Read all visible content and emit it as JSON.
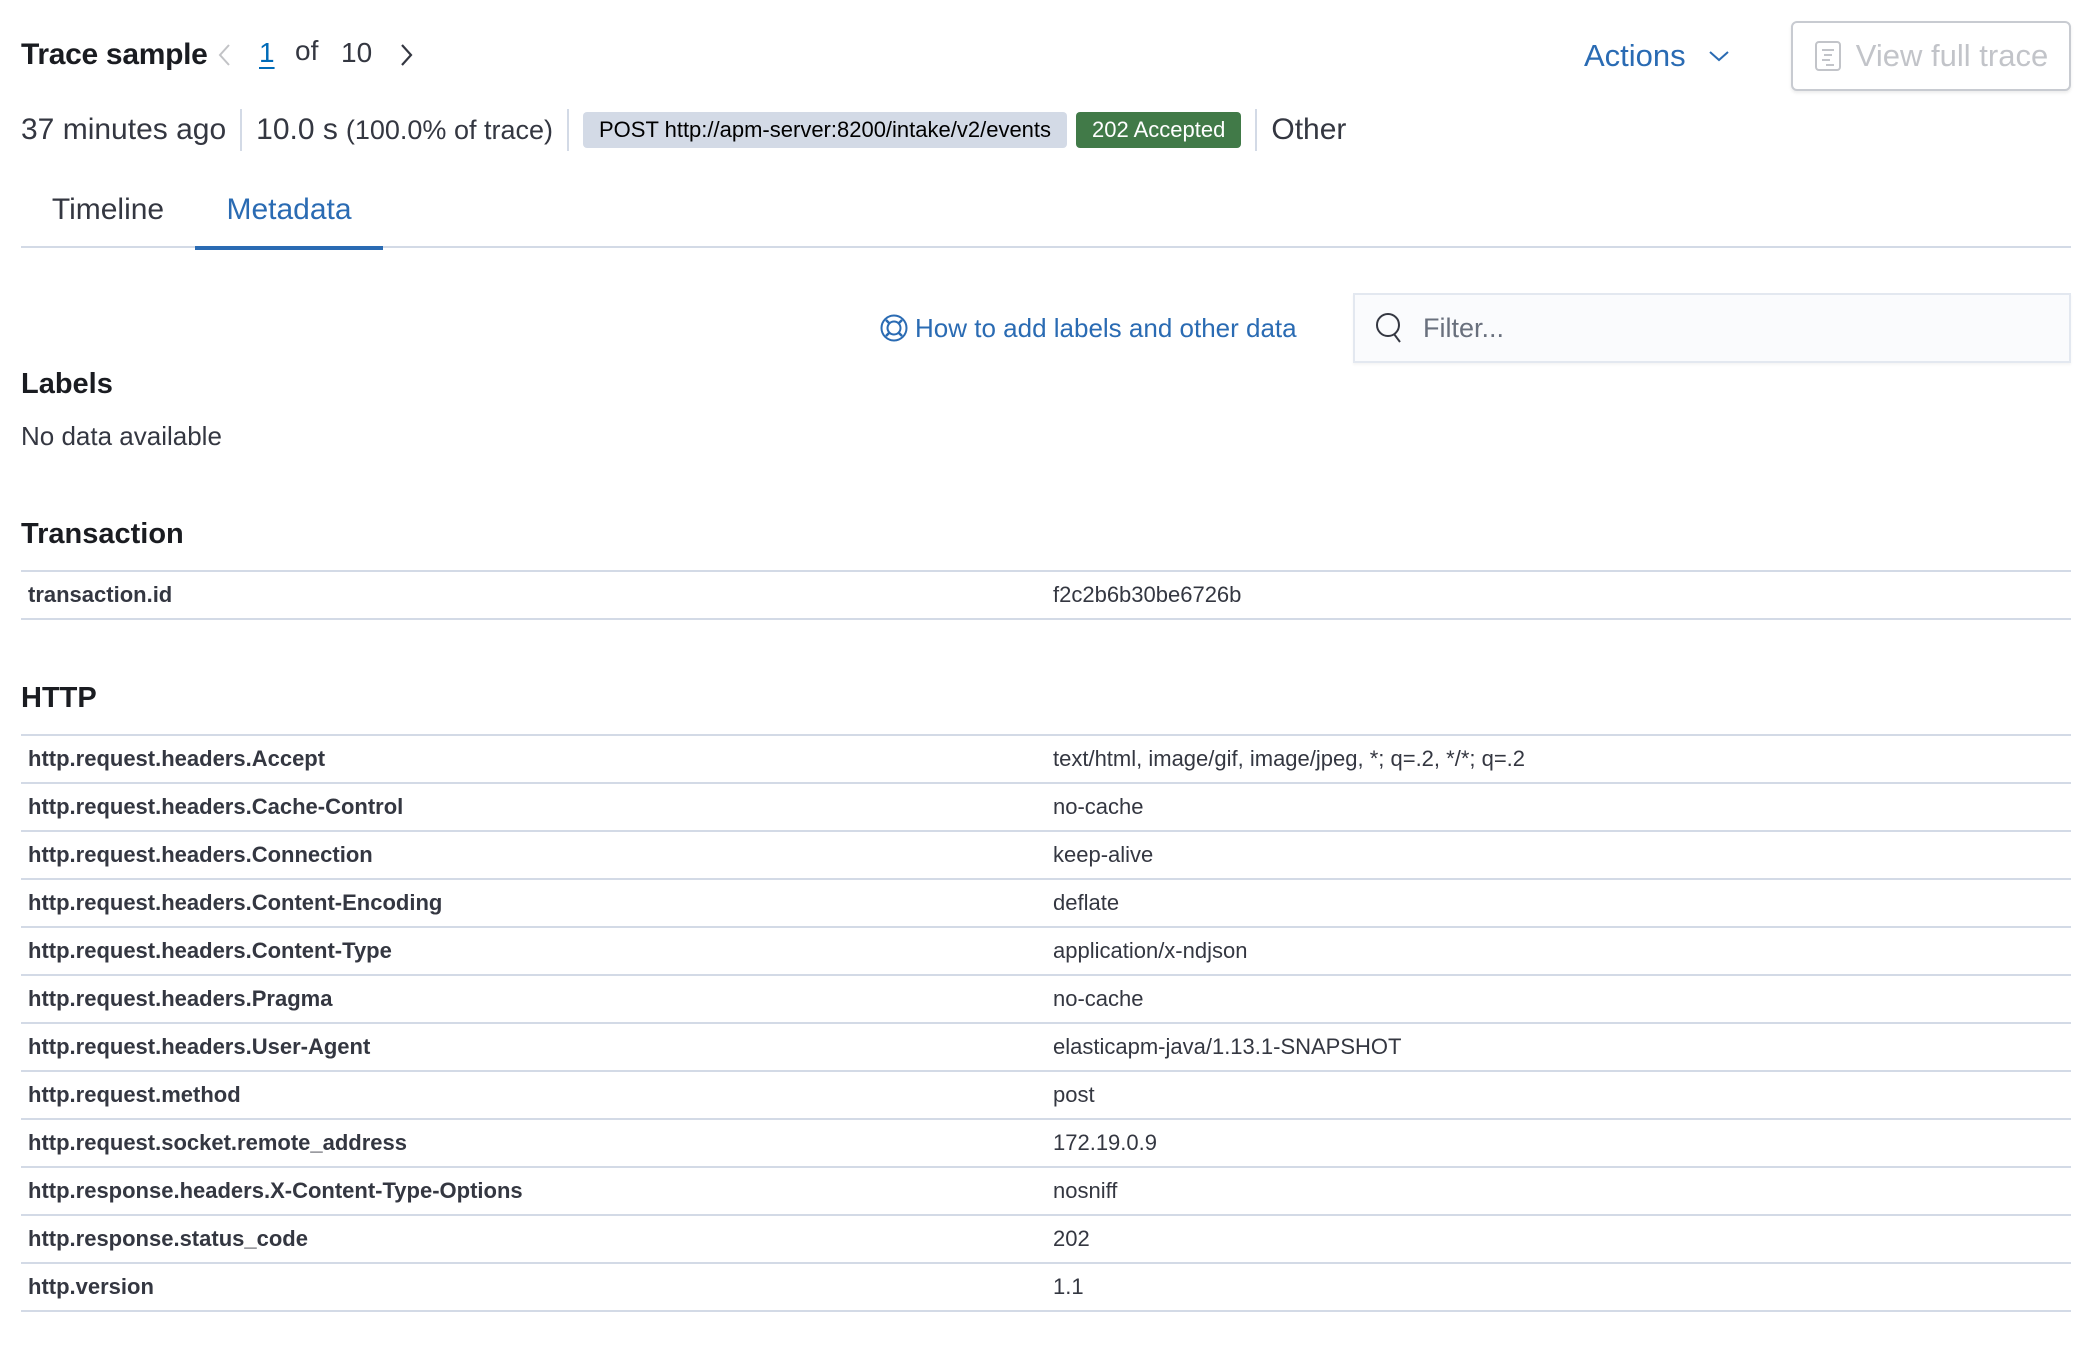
{
  "header": {
    "title": "Trace sample",
    "pager": {
      "current": "1",
      "of_label": "of",
      "total": "10"
    },
    "actions_label": "Actions",
    "view_full_trace_label": "View full trace"
  },
  "summary": {
    "time_ago": "37 minutes ago",
    "duration": "10.0 s",
    "duration_pct": "(100.0% of trace)",
    "request": "POST http://apm-server:8200/intake/v2/events",
    "status": "202 Accepted",
    "status_color": "#417a48",
    "type": "Other"
  },
  "tabs": [
    {
      "label": "Timeline",
      "active": false
    },
    {
      "label": "Metadata",
      "active": true
    }
  ],
  "help_link": {
    "label": "How to add labels and other data",
    "icon": "lifebuoy-icon"
  },
  "filter": {
    "placeholder": "Filter...",
    "value": ""
  },
  "sections": {
    "labels": {
      "title": "Labels",
      "empty_text": "No data available"
    },
    "transaction": {
      "title": "Transaction",
      "rows": [
        {
          "key": "transaction.id",
          "value": "f2c2b6b30be6726b"
        }
      ]
    },
    "http": {
      "title": "HTTP",
      "rows": [
        {
          "key": "http.request.headers.Accept",
          "value": "text/html, image/gif, image/jpeg, *; q=.2, */*; q=.2"
        },
        {
          "key": "http.request.headers.Cache-Control",
          "value": "no-cache"
        },
        {
          "key": "http.request.headers.Connection",
          "value": "keep-alive"
        },
        {
          "key": "http.request.headers.Content-Encoding",
          "value": "deflate"
        },
        {
          "key": "http.request.headers.Content-Type",
          "value": "application/x-ndjson"
        },
        {
          "key": "http.request.headers.Pragma",
          "value": "no-cache"
        },
        {
          "key": "http.request.headers.User-Agent",
          "value": "elasticapm-java/1.13.1-SNAPSHOT"
        },
        {
          "key": "http.request.method",
          "value": "post"
        },
        {
          "key": "http.request.socket.remote_address",
          "value": "172.19.0.9"
        },
        {
          "key": "http.response.headers.X-Content-Type-Options",
          "value": "nosniff"
        },
        {
          "key": "http.response.status_code",
          "value": "202"
        },
        {
          "key": "http.version",
          "value": "1.1"
        }
      ]
    }
  }
}
